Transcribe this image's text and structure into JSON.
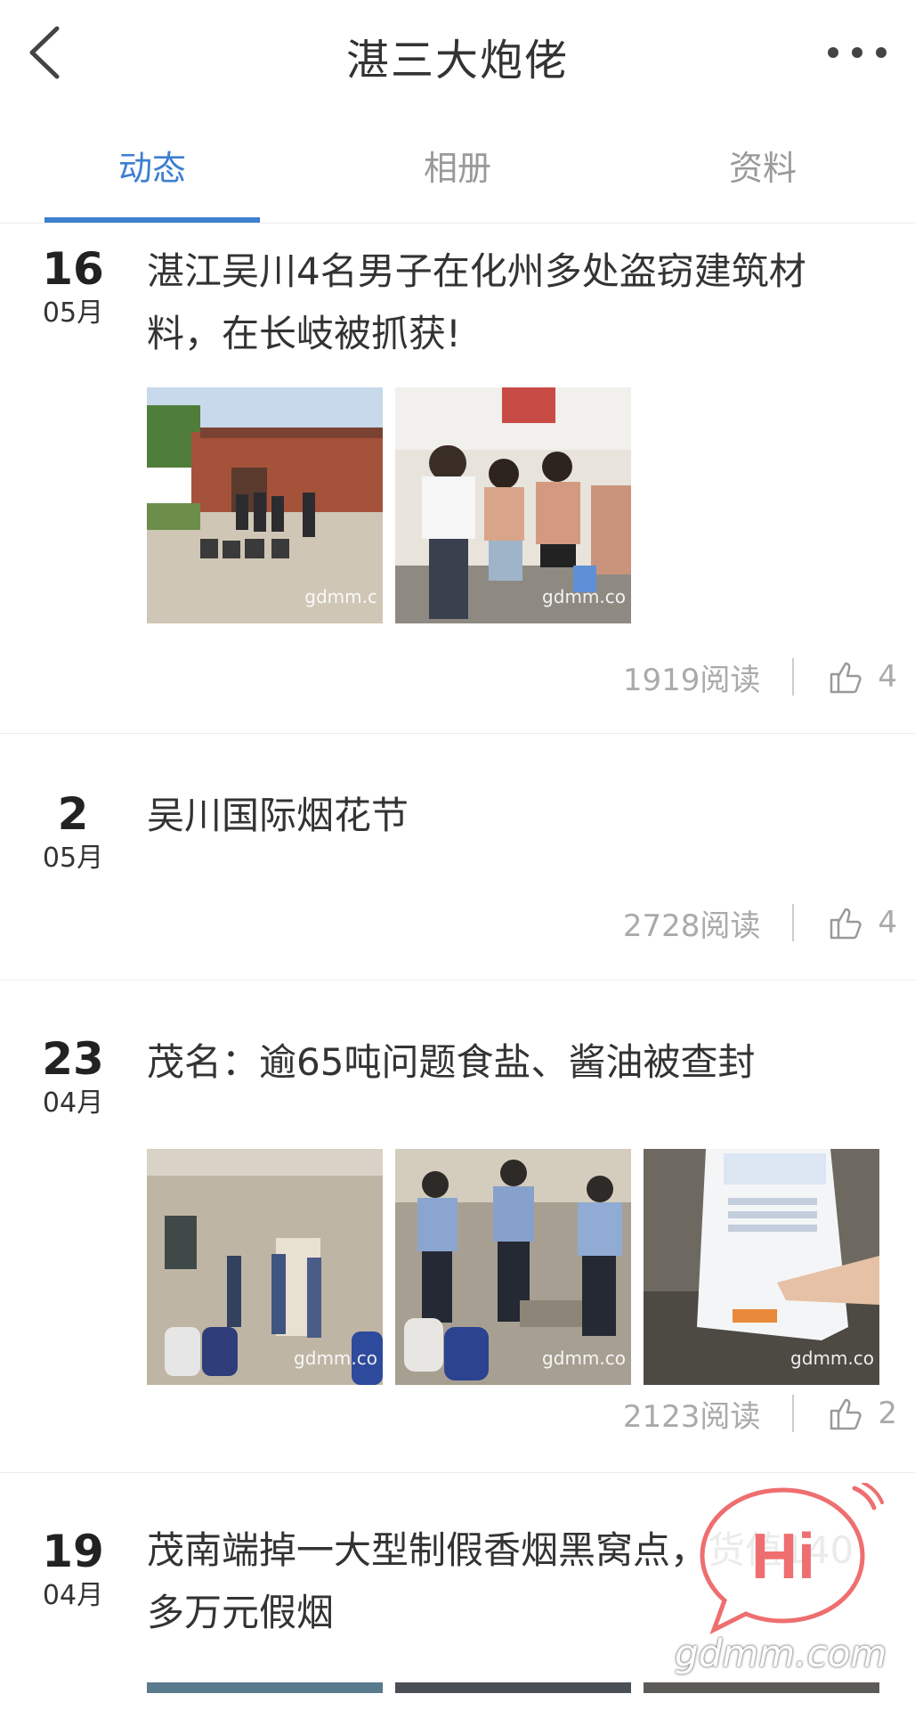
{
  "header": {
    "title": "湛三大炮佬"
  },
  "tabs": [
    {
      "label": "动态",
      "active": true
    },
    {
      "label": "相册",
      "active": false
    },
    {
      "label": "资料",
      "active": false
    }
  ],
  "accent": "#3d7fd1",
  "posts": [
    {
      "day": "16",
      "month": "05月",
      "title": "湛江吴川4名男子在化州多处盗窃建筑材料，在长岐被抓获!",
      "reads": "1919阅读",
      "likes": "4",
      "image_count": 2,
      "image_watermarks": [
        "gdmm.c",
        "gdmm.co"
      ]
    },
    {
      "day": "2",
      "month": "05月",
      "title": "吴川国际烟花节",
      "reads": "2728阅读",
      "likes": "4",
      "image_count": 0
    },
    {
      "day": "23",
      "month": "04月",
      "title": "茂名：逾65吨问题食盐、酱油被查封",
      "reads": "2123阅读",
      "likes": "2",
      "image_count": 3,
      "image_watermarks": [
        "gdmm.co",
        "gdmm.co",
        "gdmm.co"
      ]
    },
    {
      "day": "19",
      "month": "04月",
      "title": "茂南端掉一大型制假香烟黑窝点，货值140多万元假烟",
      "image_count": 3
    }
  ],
  "floating": {
    "hi_label": "Hi"
  },
  "watermark": "gdmm.com"
}
